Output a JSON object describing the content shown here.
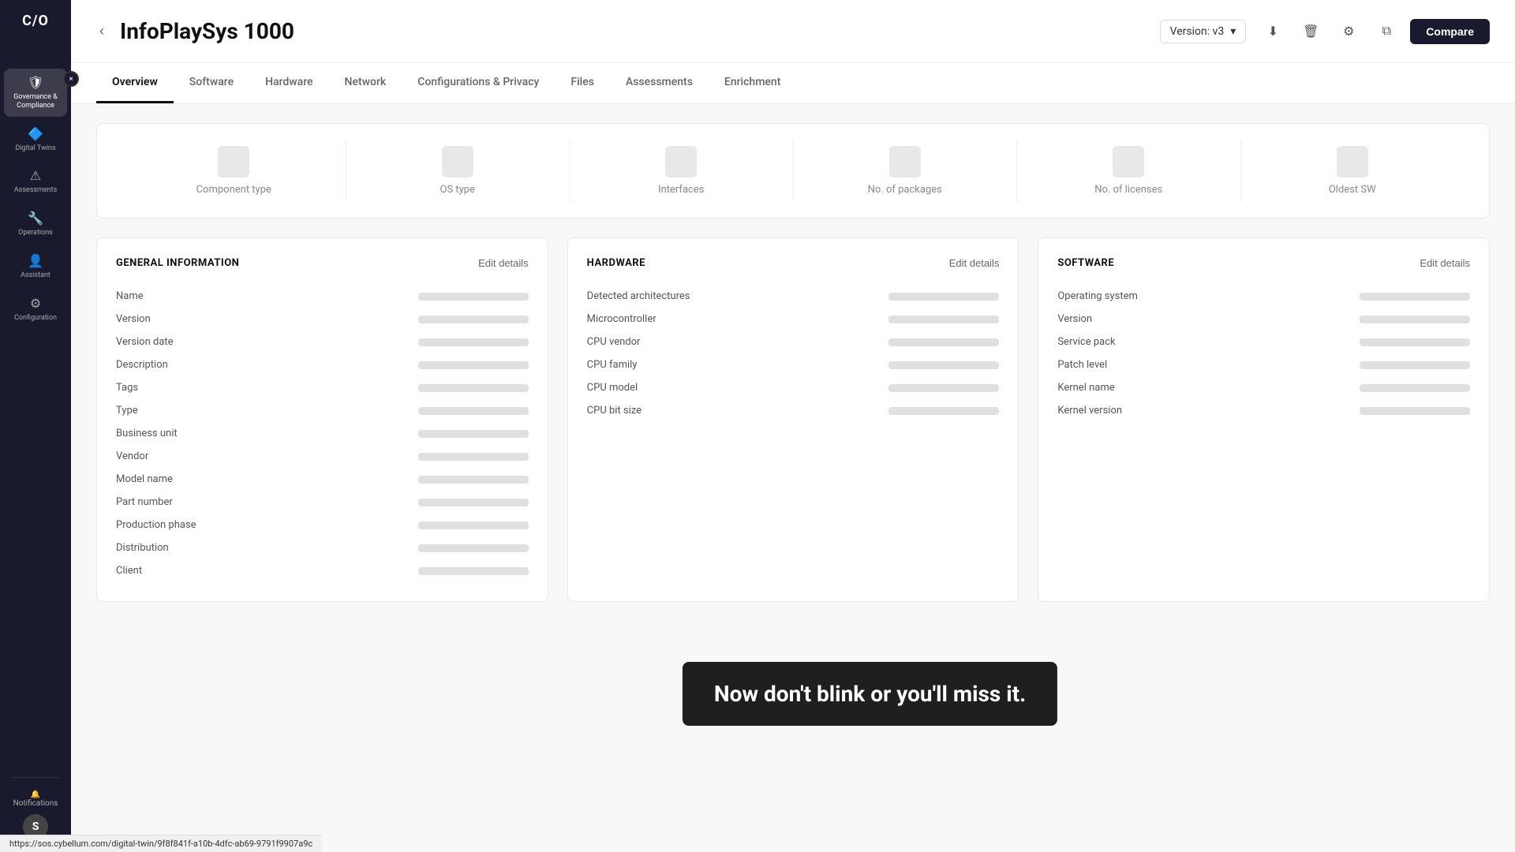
{
  "sidebar": {
    "logo": "C/O",
    "expand_icon": "×",
    "items": [
      {
        "id": "governance",
        "icon": "🛡",
        "label": "Governance & Compliance",
        "active": true
      },
      {
        "id": "digital-twins",
        "icon": "🔷",
        "label": "Digital Twins",
        "active": false
      },
      {
        "id": "assessments",
        "icon": "⚠",
        "label": "Assessments",
        "active": false
      },
      {
        "id": "operations",
        "icon": "🔧",
        "label": "Operations",
        "active": false
      },
      {
        "id": "assistant",
        "icon": "👤",
        "label": "Assistant",
        "active": false
      },
      {
        "id": "configuration",
        "icon": "⚙",
        "label": "Configuration",
        "active": false
      }
    ],
    "notifications_label": "Notifications",
    "avatar_label": "S"
  },
  "header": {
    "back_icon": "‹",
    "title": "InfoPlaySys 1000",
    "version_label": "Version: v3",
    "version_chevron": "▾",
    "actions": {
      "download_icon": "⬇",
      "delete_icon": "🗑",
      "settings_icon": "⚙",
      "share_icon": "⧉",
      "compare_label": "Compare"
    }
  },
  "tabs": [
    {
      "id": "overview",
      "label": "Overview",
      "active": true
    },
    {
      "id": "software",
      "label": "Software",
      "active": false
    },
    {
      "id": "hardware",
      "label": "Hardware",
      "active": false
    },
    {
      "id": "network",
      "label": "Network",
      "active": false
    },
    {
      "id": "configurations",
      "label": "Configurations & Privacy",
      "active": false
    },
    {
      "id": "files",
      "label": "Files",
      "active": false
    },
    {
      "id": "assessments",
      "label": "Assessments",
      "active": false
    },
    {
      "id": "enrichment",
      "label": "Enrichment",
      "active": false
    }
  ],
  "stats": [
    {
      "id": "component-type",
      "label": "Component type"
    },
    {
      "id": "os-type",
      "label": "OS type"
    },
    {
      "id": "interfaces",
      "label": "Interfaces"
    },
    {
      "id": "no-packages",
      "label": "No. of packages"
    },
    {
      "id": "no-licenses",
      "label": "No. of licenses"
    },
    {
      "id": "oldest-sw",
      "label": "Oldest SW"
    }
  ],
  "general_info": {
    "title": "GENERAL INFORMATION",
    "edit_label": "Edit details",
    "rows": [
      {
        "label": "Name"
      },
      {
        "label": "Version"
      },
      {
        "label": "Version date"
      },
      {
        "label": "Description"
      },
      {
        "label": "Tags"
      },
      {
        "label": "Type"
      },
      {
        "label": "Business unit"
      },
      {
        "label": "Vendor"
      },
      {
        "label": "Model name"
      },
      {
        "label": "Part number"
      },
      {
        "label": "Production phase"
      },
      {
        "label": "Distribution"
      },
      {
        "label": "Client"
      }
    ]
  },
  "hardware": {
    "title": "HARDWARE",
    "edit_label": "Edit details",
    "rows": [
      {
        "label": "Detected architectures"
      },
      {
        "label": "Microcontroller"
      },
      {
        "label": "CPU vendor"
      },
      {
        "label": "CPU family"
      },
      {
        "label": "CPU model"
      },
      {
        "label": "CPU bit size"
      }
    ]
  },
  "software": {
    "title": "SOFTWARE",
    "edit_label": "Edit details",
    "rows": [
      {
        "label": "Operating system"
      },
      {
        "label": "Version"
      },
      {
        "label": "Service pack"
      },
      {
        "label": "Patch level"
      },
      {
        "label": "Kernel name"
      },
      {
        "label": "Kernel version"
      }
    ]
  },
  "toast": {
    "message": "Now don't  blink or you'll miss it."
  },
  "url_bar": {
    "url": "https://sos.cybellum.com/digital-twin/9f8f841f-a10b-4dfc-ab69-9791f9907a9c"
  }
}
